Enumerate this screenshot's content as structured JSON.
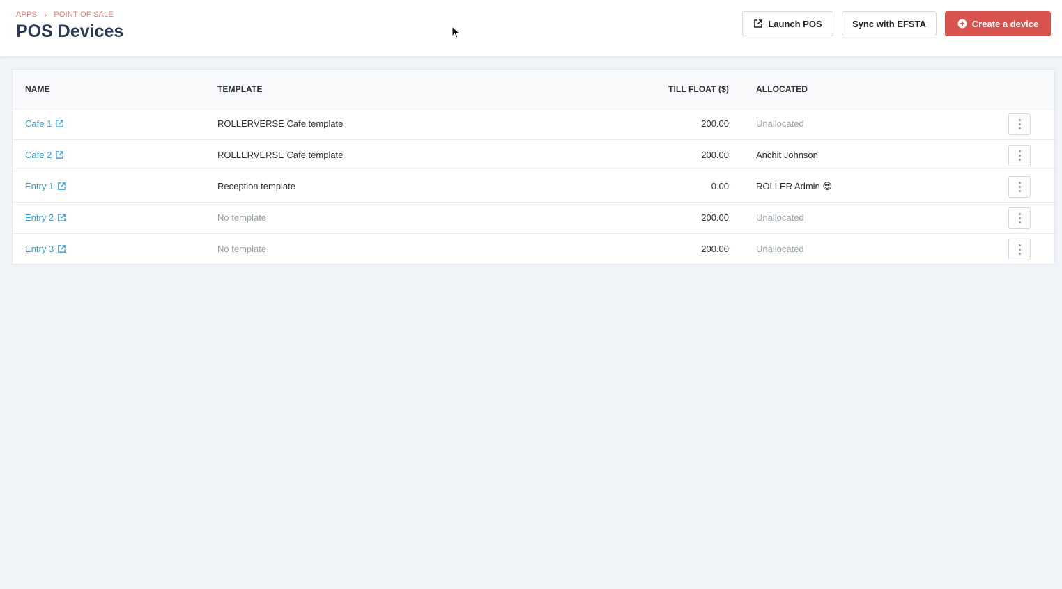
{
  "breadcrumb": {
    "items": [
      "APPS",
      "POINT OF SALE"
    ]
  },
  "page": {
    "title": "POS Devices"
  },
  "actions": {
    "launch_label": "Launch POS",
    "sync_label": "Sync with EFSTA",
    "create_label": "Create a device"
  },
  "colors": {
    "accent": "#d9534f",
    "link": "#3aa0d8",
    "breadcrumb": "#e37e6e",
    "title": "#2a3a55"
  },
  "table": {
    "headers": {
      "name": "NAME",
      "template": "TEMPLATE",
      "till_float": "TILL FLOAT ($)",
      "allocated": "ALLOCATED"
    },
    "rows": [
      {
        "name": "Cafe 1",
        "template": "ROLLERVERSE Cafe template",
        "till_float": "200.00",
        "allocated": "Unallocated"
      },
      {
        "name": "Cafe 2",
        "template": "ROLLERVERSE Cafe template",
        "till_float": "200.00",
        "allocated": "Anchit Johnson"
      },
      {
        "name": "Entry 1",
        "template": "Reception template",
        "till_float": "0.00",
        "allocated": "ROLLER Admin 😎"
      },
      {
        "name": "Entry 2",
        "template": "No template",
        "till_float": "200.00",
        "allocated": "Unallocated"
      },
      {
        "name": "Entry 3",
        "template": "No template",
        "till_float": "200.00",
        "allocated": "Unallocated"
      }
    ]
  }
}
